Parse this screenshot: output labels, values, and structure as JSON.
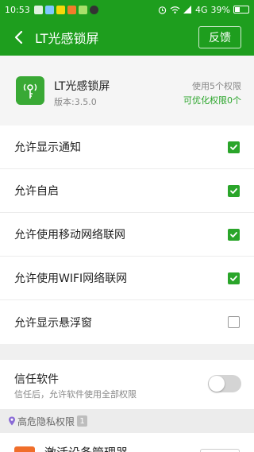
{
  "status_bar": {
    "time": "10:53",
    "network": "4G",
    "battery": "39%",
    "battery_level": 0.39,
    "notification_icons": [
      "qq-icon",
      "message-icon",
      "app-icon-yellow",
      "app-icon-orange",
      "app-icon-green",
      "app-icon-dark"
    ]
  },
  "header": {
    "title": "LT光感锁屏",
    "feedback_label": "反馈"
  },
  "app_info": {
    "name": "LT光感锁屏",
    "version": "版本:3.5.0",
    "permissions_used": "使用5个权限",
    "permissions_optimizable": "可优化权限0个"
  },
  "permissions": [
    {
      "label": "允许显示通知",
      "checked": true
    },
    {
      "label": "允许自启",
      "checked": true
    },
    {
      "label": "允许使用移动网络联网",
      "checked": true
    },
    {
      "label": "允许使用WIFI网络联网",
      "checked": true
    },
    {
      "label": "允许显示悬浮窗",
      "checked": false
    }
  ],
  "trust": {
    "title": "信任软件",
    "subtitle": "信任后，允许软件使用全部权限",
    "enabled": false
  },
  "high_risk": {
    "label": "高危隐私权限",
    "count": "1"
  },
  "next_item": {
    "label": "激活设备管理器"
  },
  "colors": {
    "brand_green": "#1e9e1e",
    "check_green": "#2aa52a",
    "text_primary": "#222222",
    "text_secondary": "#888888"
  }
}
